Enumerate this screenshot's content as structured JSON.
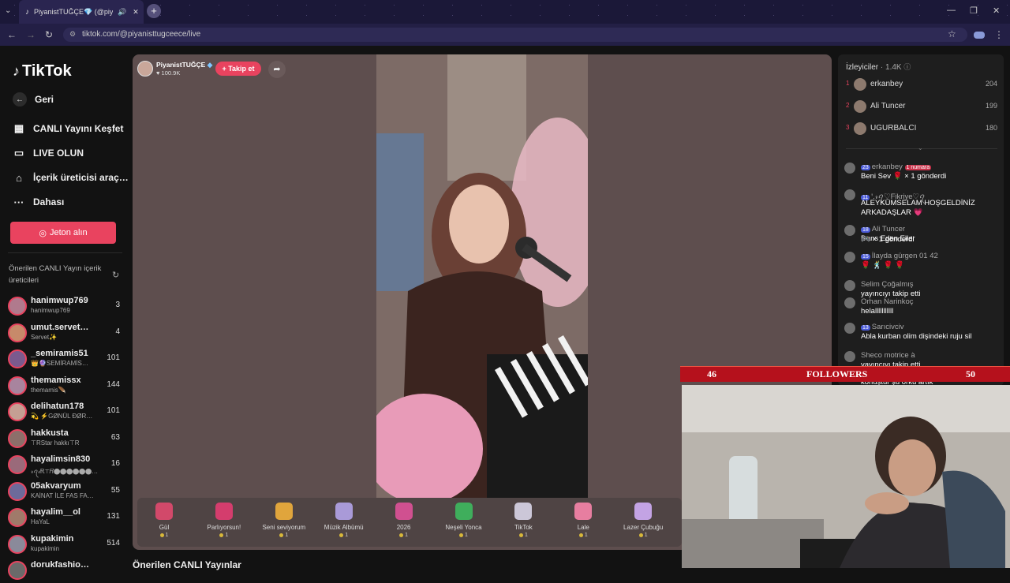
{
  "browser": {
    "tab_title": "PiyanistTUĞÇE💎 (@piyan…",
    "url": "tiktok.com/@piyanisttugceece/live"
  },
  "sidebar": {
    "logo": "TikTok",
    "back": "Geri",
    "nav": [
      {
        "label": "CANLI Yayını Keşfet",
        "icon": "calendar-icon"
      },
      {
        "label": "LIVE OLUN",
        "icon": "camera-icon"
      },
      {
        "label": "İçerik üreticisi araç…",
        "icon": "creator-tools-icon"
      },
      {
        "label": "Dahası",
        "icon": "more-icon"
      }
    ],
    "jeton_button": "Jeton alın",
    "suggested_title": "Önerilen CANLI Yayın içerik üreticileri",
    "creators": [
      {
        "name": "hanimwup769",
        "sub": "hanimwup769",
        "count": "3"
      },
      {
        "name": "umut.servet…",
        "sub": "Servet✨",
        "count": "4"
      },
      {
        "name": "_semiramis51",
        "sub": "👑🔮SEMİRAMİS…",
        "count": "101"
      },
      {
        "name": "themamissx",
        "sub": "themamis🪶",
        "count": "144"
      },
      {
        "name": "delihatun178",
        "sub": "💫 ⚡GØNÜL ĐØR…",
        "count": "101"
      },
      {
        "name": "hakkusta",
        "sub": "⊤RStar hakkı⊤R",
        "count": "63"
      },
      {
        "name": "hayalimsin830",
        "sub": "𝓇ꪖ𝒾Ꭱ⊤𝑅⬤⬤⬤⬤⬤⬤…",
        "count": "16"
      },
      {
        "name": "05akvaryum",
        "sub": "KAİNAT İLE FAS FA…",
        "count": "55"
      },
      {
        "name": "hayalim__ol",
        "sub": "HaYaL",
        "count": "131"
      },
      {
        "name": "kupakimin",
        "sub": "kupakimin",
        "count": "514"
      },
      {
        "name": "dorukfashio…",
        "sub": "",
        "count": ""
      }
    ]
  },
  "live": {
    "host_name": "PiyanistTUĞÇE",
    "host_likes": "100.9K",
    "follow_button": "+ Takip et",
    "bottom_title": "Önerilen CANLI Yayınlar"
  },
  "gifts": [
    {
      "label": "Gül",
      "price": "1",
      "color": "#d2496a"
    },
    {
      "label": "Parlıyorsun!",
      "price": "1",
      "color": "#d43d6d"
    },
    {
      "label": "Seni seviyorum",
      "price": "1",
      "color": "#e0a53c"
    },
    {
      "label": "Müzik Albümü",
      "price": "1",
      "color": "#a99ad8"
    },
    {
      "label": "2026",
      "price": "1",
      "color": "#d05090"
    },
    {
      "label": "Neşeli Yonca",
      "price": "1",
      "color": "#3fae5c"
    },
    {
      "label": "TikTok",
      "price": "1",
      "color": "#ccc7d8"
    },
    {
      "label": "Lale",
      "price": "1",
      "color": "#e77ea0"
    },
    {
      "label": "Lazer Çubuğu",
      "price": "1",
      "color": "#c3a3e4"
    }
  ],
  "viewers": {
    "title": "İzleyiciler",
    "count": "1.4K",
    "top": [
      {
        "rank": "1",
        "name": "erkanbey",
        "score": "204"
      },
      {
        "rank": "2",
        "name": "Ali Tuncer",
        "score": "199"
      },
      {
        "rank": "3",
        "name": "UGURBALCI",
        "score": "180"
      }
    ]
  },
  "chat": [
    {
      "user": "erkanbey",
      "badge": "23",
      "extra": "1 numara",
      "text": "Beni Sev 🌹 × 1 gönderdi"
    },
    {
      "user": "ꞌ.𝓇ꪖ♡Fikriye♡ꪖ",
      "badge": "11",
      "extra": "",
      "text": "ALEYKÜMSELAM HOŞGELDİNİZ"
    },
    {
      "user": "",
      "badge": "",
      "extra": "",
      "text": "ARKADAŞLAR 💗"
    },
    {
      "user": "Ali Tuncer",
      "badge": "18",
      "extra": "",
      "text": "Dans Eden Eller"
    },
    {
      "user": "",
      "badge": "",
      "extra": "",
      "text": "🎮 × 1 gönderdi"
    },
    {
      "user": "İlayda gürgen 01 42",
      "badge": "15",
      "extra": "",
      "text": "🌹 🕺 🌹 🌹"
    },
    {
      "user": "Selim Çoğalmış",
      "badge": "",
      "extra": "",
      "text": "yayıncıyı takip etti"
    },
    {
      "user": "Orhan Narinkoç",
      "badge": "",
      "extra": "",
      "text": "helalllllllllll"
    },
    {
      "user": "Sarıcivciv",
      "badge": "13",
      "extra": "",
      "text": "Abla kurban olim dişindeki ruju sil"
    },
    {
      "user": "Sheco motrice à",
      "badge": "",
      "extra": "",
      "text": "yayıncıyı takip etti"
    },
    {
      "user": "",
      "badge": "",
      "extra": "",
      "text": "konuştur şu örkü artık"
    }
  ],
  "overlay": {
    "followers_label": "FOLLOWERS",
    "current": "46",
    "goal": "50"
  }
}
